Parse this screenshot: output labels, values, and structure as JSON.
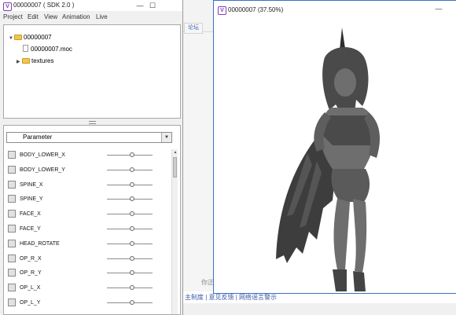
{
  "background": {
    "link_text": "论坛",
    "status_text": "主制度 | 意见反馈 | 网络谣言警示",
    "note_text": "你正",
    "badge": "S"
  },
  "sdk_window": {
    "title": "00000007 ( SDK 2.0 )",
    "icon_glyph": "V",
    "controls": {
      "minimize": "—",
      "maximize": "☐"
    },
    "menu": [
      "Project",
      "Edit",
      "View",
      "Animation",
      "Live"
    ],
    "tree": {
      "root": "00000007",
      "moc_file": "00000007.moc",
      "textures": "textures"
    },
    "parameter_dropdown": {
      "selected": "Parameter"
    },
    "parameters": [
      {
        "label": "BODY_LOWER_X",
        "value": 0.55
      },
      {
        "label": "BODY_LOWER_Y",
        "value": 0.55
      },
      {
        "label": "SPINE_X",
        "value": 0.55
      },
      {
        "label": "SPINE_Y",
        "value": 0.55
      },
      {
        "label": "FACE_X",
        "value": 0.55
      },
      {
        "label": "FACE_Y",
        "value": 0.55
      },
      {
        "label": "HEAD_ROTATE",
        "value": 0.55
      },
      {
        "label": "OP_R_X",
        "value": 0.55
      },
      {
        "label": "OP_R_Y",
        "value": 0.55
      },
      {
        "label": "OP_L_X",
        "value": 0.55
      },
      {
        "label": "OP_L_Y",
        "value": 0.55
      }
    ]
  },
  "preview_window": {
    "title": "00000007 (37.50%)",
    "icon_glyph": "V",
    "minimize": "—"
  },
  "colors": {
    "accent": "#7d3fb8",
    "preview_border": "#3a6fc4",
    "model_gray": "#6e6e6e",
    "model_dark": "#3d3d3d"
  }
}
